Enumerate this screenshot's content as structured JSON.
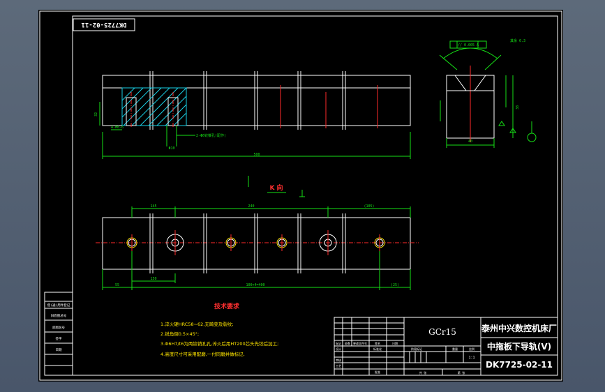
{
  "drawing": {
    "stamp_code": "DK7725-02-11",
    "view_label": "K 向",
    "dims": {
      "length_total": "500",
      "width_right_view": "40",
      "height_right_view": "38",
      "dim_145": "145",
      "dim_240": "240",
      "dim_105": "(105)",
      "dim_55": "55",
      "dim_150": "150",
      "dim_pitch": "100×4=400",
      "dim_25": "(25)",
      "hole_note": "2-Φ6铰锥孔(配作)",
      "small_dim": "Φ10",
      "left_dim": "4-M8-6",
      "dim_32": "32",
      "tolerance_frame": "// 0.005 A",
      "rough": "其余 6.3"
    },
    "notes": {
      "title": "技术要求",
      "items": [
        "1.淬火硬HRC58~62,无畸变及裂纹;",
        "2.锐角倒0.5×45°;",
        "3.Φ6H7/t6为两铰销孔孔,淬火后用HT200芯头先铰后加工;",
        "4.高度尺寸可采用配磨,一付同磨并做标记."
      ]
    },
    "title_block": {
      "material": "GCr15",
      "company": "泰州中兴数控机床厂",
      "part_name": "中拖板下导轨(V)",
      "drawing_no": "DK7725-02-11",
      "scale": "1:1",
      "labels": {
        "mark": "标记",
        "count": "处数",
        "change_doc": "更改文件号",
        "sign": "签名",
        "date": "日期",
        "design": "设计",
        "standard": "标准化",
        "stage_mark": "阶段标记",
        "weight": "重量",
        "ratio": "比例",
        "review": "审核",
        "process": "工艺",
        "approve": "批准",
        "sheets": "共 张",
        "sheet": "第 张"
      }
    },
    "left_strip": [
      "借(通)用件登记",
      "旧底图总号",
      "底图总号",
      "签字",
      "日期"
    ]
  },
  "colors": {
    "outline": "#ffffff",
    "dimension": "#16e016",
    "centerline": "#ff2a2a",
    "hatch": "#19d0e6",
    "text": "#ffe600"
  }
}
